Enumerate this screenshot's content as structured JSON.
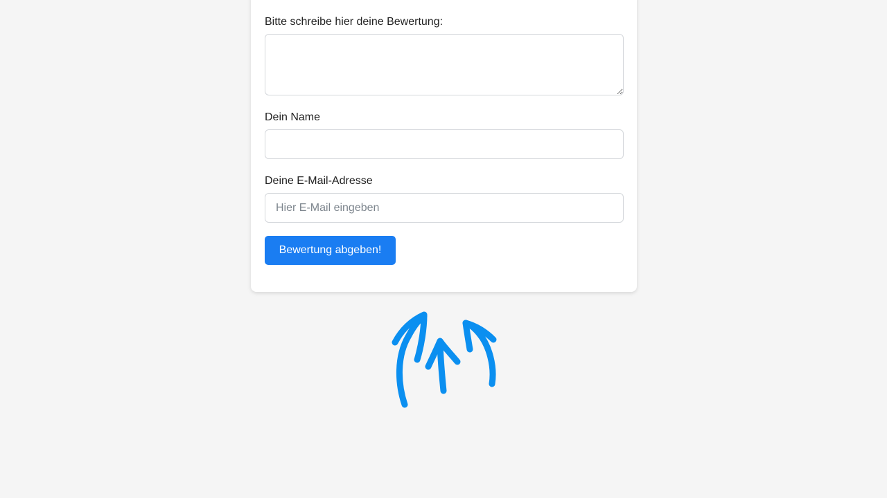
{
  "form": {
    "review_label": "Bitte schreibe hier deine Bewertung:",
    "review_value": "",
    "name_label": "Dein Name",
    "name_value": "",
    "email_label": "Deine E-Mail-Adresse",
    "email_placeholder": "Hier E-Mail eingeben",
    "submit_label": "Bewertung abgeben!"
  },
  "colors": {
    "accent": "#1a7df2",
    "arrows": "#0b8ff0",
    "background": "#f5f5f5"
  },
  "decoration": {
    "icon": "hand-drawn-up-arrows-icon"
  }
}
